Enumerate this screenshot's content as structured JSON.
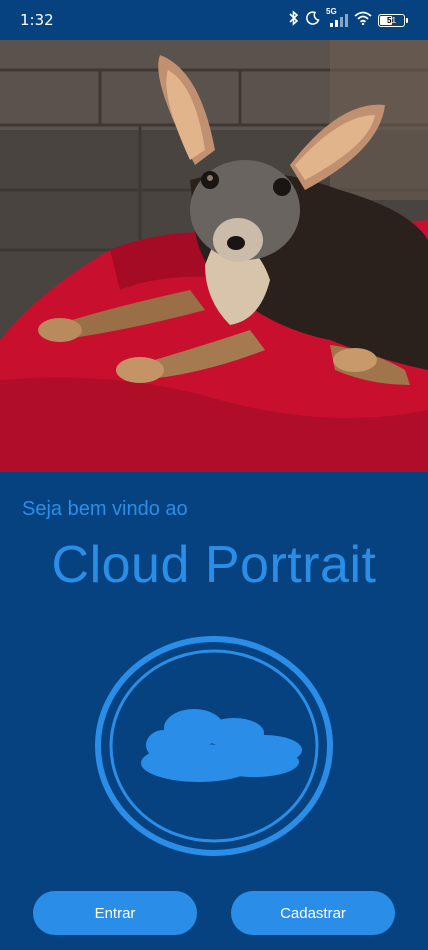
{
  "status_bar": {
    "time": "1:32",
    "network_label": "5G",
    "battery_level": "51",
    "icons": [
      "bluetooth-icon",
      "moon-icon",
      "signal-icon",
      "wifi-icon",
      "battery-icon"
    ]
  },
  "hero": {
    "image": "photo-of-chihuahua-on-red-cushion"
  },
  "welcome": {
    "subtitle": "Seja bem vindo ao",
    "app_name": "Cloud Portrait"
  },
  "logo": {
    "icon": "cloud-icon",
    "color": "#2a8ee8"
  },
  "actions": {
    "login_label": "Entrar",
    "signup_label": "Cadastrar"
  },
  "colors": {
    "background": "#06427f",
    "accent": "#2a8ee8",
    "button_text": "#ffffff"
  }
}
